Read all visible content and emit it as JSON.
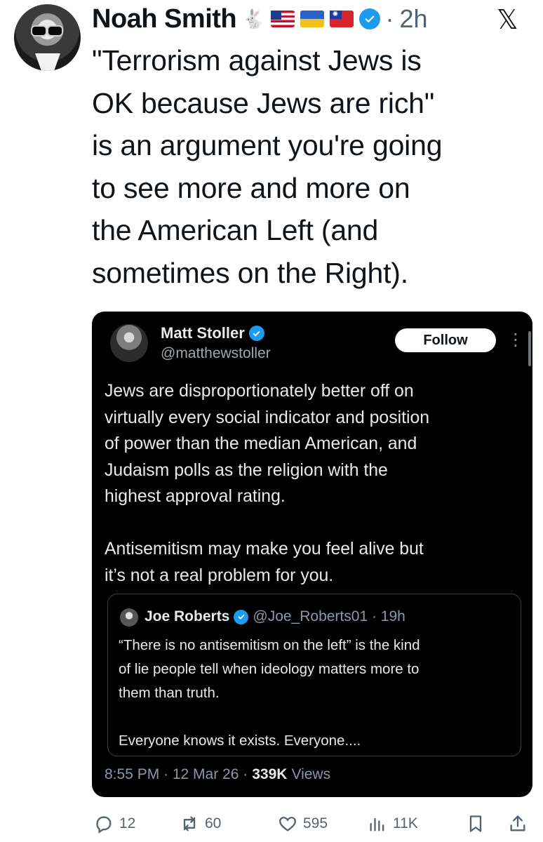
{
  "tweet": {
    "author": {
      "name": "Noah Smith",
      "emoji_1": "🐇",
      "flags": [
        "us-flag",
        "ukraine-flag",
        "taiwan-flag"
      ],
      "time": "2h",
      "separator": "·"
    },
    "text": "\"Terrorism against Jews is\nOK because Jews are rich\"\nis an argument you're going\nto see more and more on\nthe American Left (and\nsometimes on the Right).",
    "x_logo": "𝕏"
  },
  "quoted": {
    "name": "Matt Stoller",
    "handle": "@matthewstoller",
    "follow_label": "Follow",
    "more": "⋮",
    "text": "Jews are disproportionately better off on\nvirtually every social indicator and position\nof power than the median American, and\nJudaism polls as the religion with the\nhighest approval rating.\n\nAntisemitism may make you feel alive but\nit’s not a real problem for you.",
    "nested": {
      "name": "Joe Roberts",
      "handle_time": "@Joe_Roberts01 · 19h",
      "text": "“There is no antisemitism on the left” is the kind\nof lie people tell when ideology matters more to\nthem than truth.\n\nEveryone knows it exists. Everyone...."
    },
    "footer": {
      "time_date": "8:55 PM · 12 Mar 26 ·",
      "views_count": "339K",
      "views_label": "Views"
    }
  },
  "actions": {
    "replies": "12",
    "reposts": "60",
    "likes": "595",
    "views": "11K"
  },
  "colors": {
    "verified": "#1d9bf0",
    "muted": "#536471",
    "card_bg": "#000000"
  }
}
